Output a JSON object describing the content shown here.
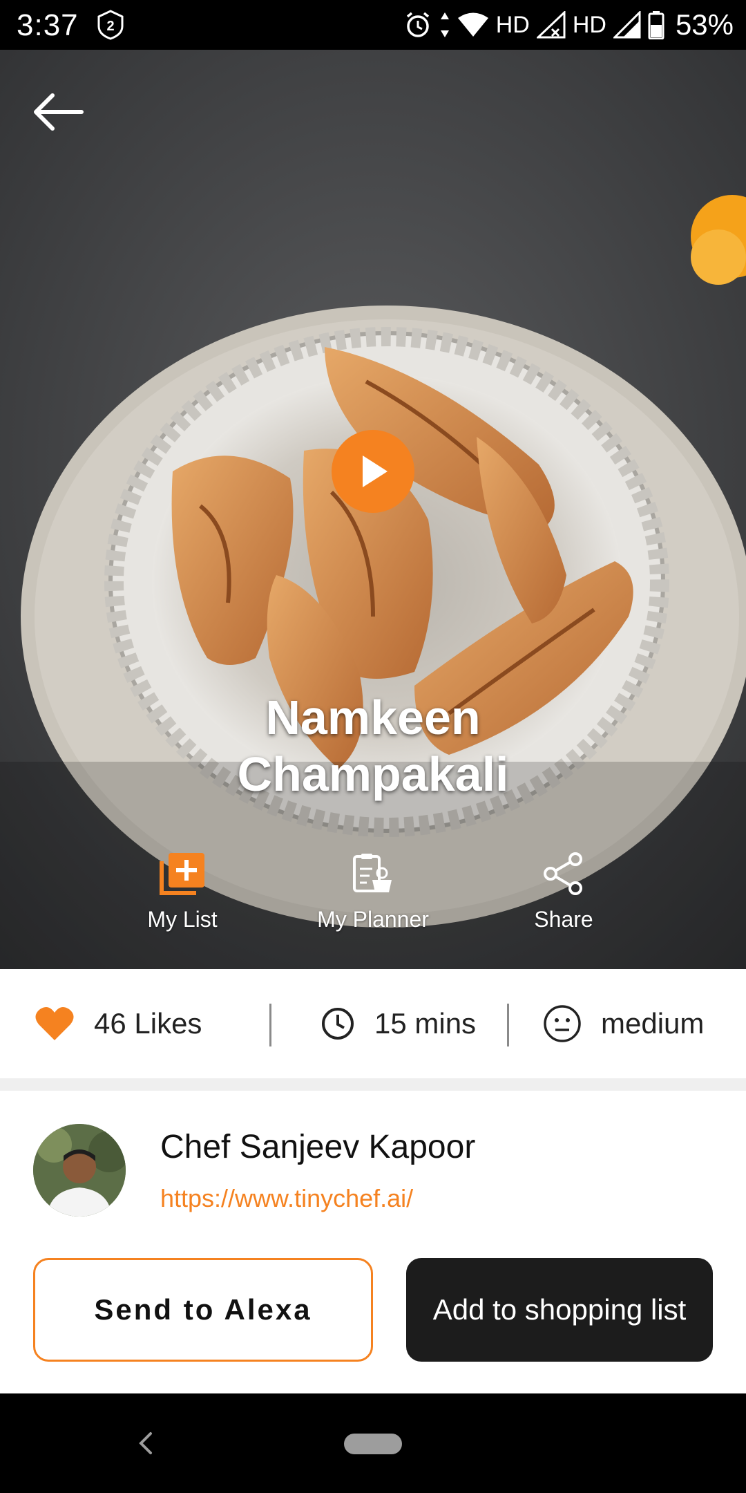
{
  "status_bar": {
    "time": "3:37",
    "network_label_1": "HD",
    "network_label_2": "HD",
    "battery": "53%",
    "icons": [
      "shield-badge-icon",
      "alarm-icon",
      "wifi-icon",
      "signal-icon",
      "battery-icon"
    ]
  },
  "hero": {
    "title_line1": "Namkeen",
    "title_line2": "Champakali",
    "actions": [
      {
        "label": "My List",
        "icon": "add-to-list-icon",
        "color": "#f58220"
      },
      {
        "label": "My Planner",
        "icon": "planner-icon"
      },
      {
        "label": "Share",
        "icon": "share-icon"
      }
    ]
  },
  "stats": {
    "likes": "46 Likes",
    "time": "15 mins",
    "difficulty": "medium"
  },
  "chef": {
    "name": "Chef Sanjeev Kapoor",
    "link": "https://www.tinychef.ai/"
  },
  "buttons": {
    "send_to_alexa": "Send to Alexa",
    "add_to_shopping_list": "Add to shopping list"
  },
  "colors": {
    "accent": "#f58220",
    "dark_button": "#1c1c1c"
  }
}
